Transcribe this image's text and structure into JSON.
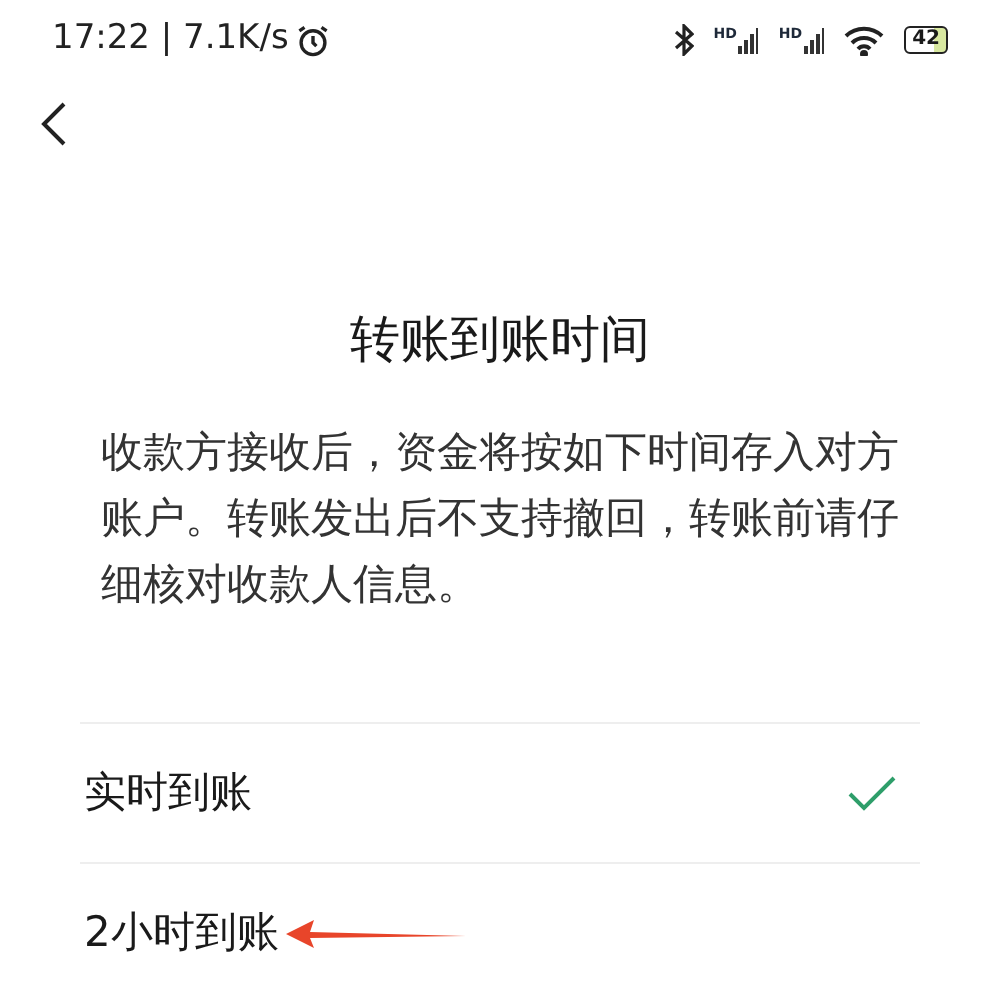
{
  "status_bar": {
    "time": "17:22 | 7.1K/s",
    "signal_labels": [
      "HD",
      "HD"
    ],
    "battery": "42"
  },
  "title": "转账到账时间",
  "description": "收款方接收后，资金将按如下时间存入对方账户。转账发出后不支持撤回，转账前请仔细核对收款人信息。",
  "options": [
    {
      "label": "实时到账",
      "selected": true
    },
    {
      "label": "2小时到账",
      "selected": false
    }
  ]
}
